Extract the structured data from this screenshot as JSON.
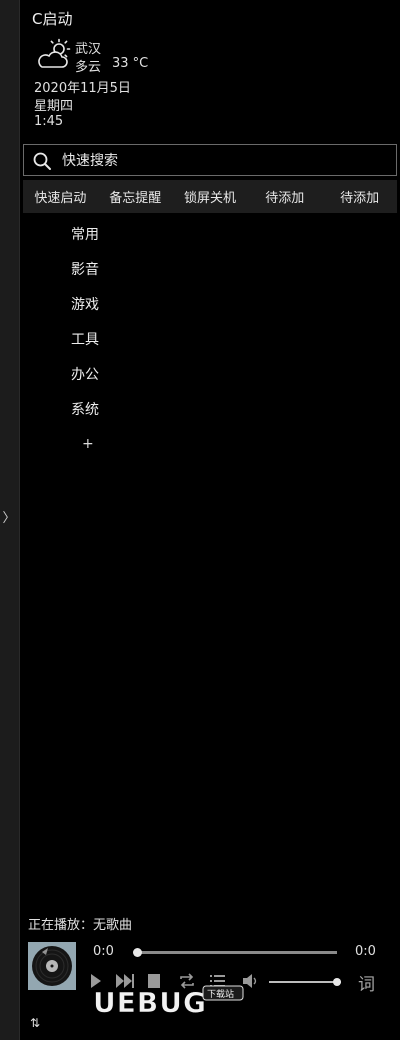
{
  "app": {
    "title": "C启动"
  },
  "weather": {
    "city": "武汉",
    "condition": "多云",
    "temperature": "33 °C",
    "icon": "partly-cloudy-icon"
  },
  "datetime": {
    "date": "2020年11月5日",
    "weekday": "星期四",
    "time": "1:45"
  },
  "search": {
    "placeholder": "快速搜索",
    "value": ""
  },
  "tabs": [
    {
      "label": "快速启动"
    },
    {
      "label": "备忘提醒"
    },
    {
      "label": "锁屏关机"
    },
    {
      "label": "待添加"
    },
    {
      "label": "待添加"
    }
  ],
  "categories": [
    {
      "label": "常用"
    },
    {
      "label": "影音"
    },
    {
      "label": "游戏"
    },
    {
      "label": "工具"
    },
    {
      "label": "办公"
    },
    {
      "label": "系统"
    }
  ],
  "add_category": "+",
  "sidebar": {
    "toggle_glyph": "〉"
  },
  "player": {
    "now_playing": "正在播放：无歌曲",
    "elapsed": "0:0",
    "duration": "0:0",
    "progress": 0,
    "volume": 0.95,
    "lyrics_label": "词"
  },
  "watermark": {
    "text": "UEBUG",
    "badge": "下载站"
  },
  "footer": {
    "sort_glyph": "⇅"
  },
  "colors": {
    "background": "#000000",
    "panel": "#1e1e1e",
    "text": "#e8e8e8",
    "border": "#6a6a6a"
  }
}
